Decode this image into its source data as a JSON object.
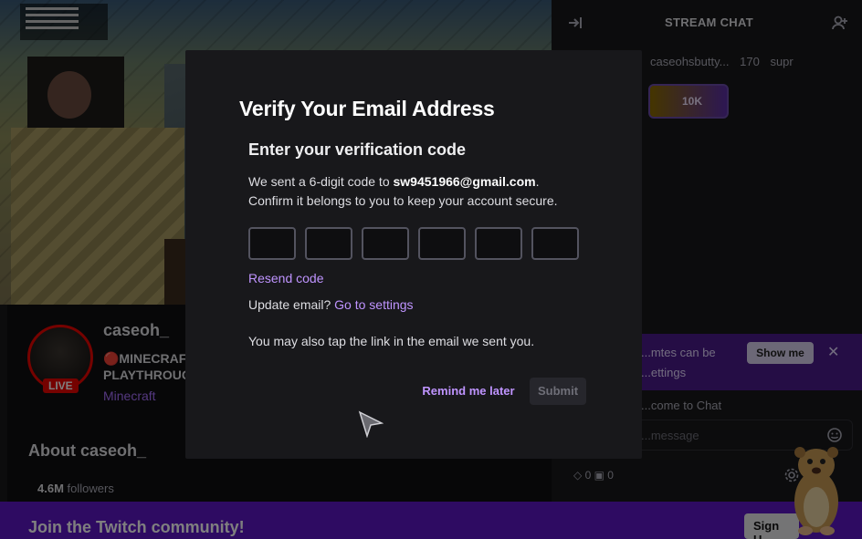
{
  "channel": {
    "name": "caseoh_",
    "live_label": "LIVE",
    "stream_title": "🔴MINECRAFT PLAYTHROUG",
    "game": "Minecraft",
    "about_title": "About caseoh_",
    "followers_count": "4.6M",
    "followers_label": "followers"
  },
  "chat": {
    "title": "STREAM CHAT",
    "gifters": [
      "caseohsbutty...",
      "170",
      "supr"
    ],
    "hype_value": "10K",
    "notice_text": "...mtes can be ...ettings",
    "show_button": "Show me",
    "welcome_text": "...come to Chat",
    "input_placeholder": "...message",
    "points_a": "0",
    "points_b": "0"
  },
  "banner": {
    "join_text": "Join the Twitch community!",
    "signup_label": "Sign U"
  },
  "modal": {
    "title": "Verify Your Email Address",
    "subtitle": "Enter your verification code",
    "desc_prefix": "We sent a 6-digit code to ",
    "email": "sw9451966@gmail.com",
    "desc_suffix": ".",
    "desc_line2": "Confirm it belongs to you to keep your account secure.",
    "code_digits": [
      "",
      "",
      "",
      "",
      "",
      ""
    ],
    "resend_label": "Resend code",
    "update_prefix": "Update email? ",
    "update_link": "Go to settings",
    "tap_text": "You may also tap the link in the email we sent you.",
    "remind_label": "Remind me later",
    "submit_label": "Submit"
  },
  "colors": {
    "accent": "#bf94ff",
    "live_red": "#eb0400",
    "join_bar": "#5c16c5",
    "modal_bg": "#18181b"
  }
}
